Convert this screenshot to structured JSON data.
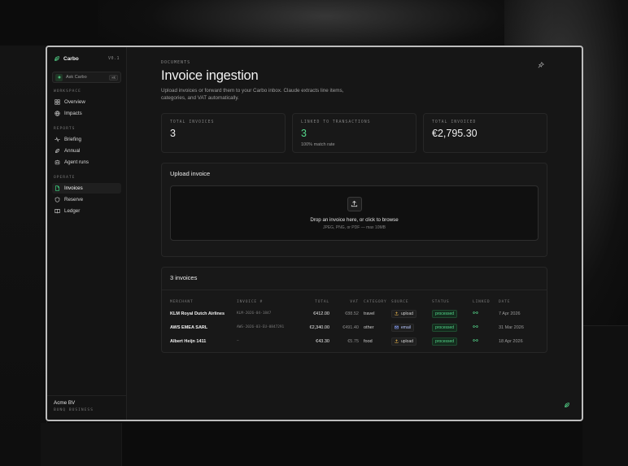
{
  "app": {
    "brand": "Carbo",
    "version": "V0.1"
  },
  "sidebar": {
    "ask_label": "Ask Carbo",
    "ask_shortcut": "⌘K",
    "sections": [
      {
        "label": "WORKSPACE",
        "items": [
          {
            "label": "Overview",
            "icon": "grid-icon"
          },
          {
            "label": "Impacts",
            "icon": "globe-icon"
          }
        ]
      },
      {
        "label": "REPORTS",
        "items": [
          {
            "label": "Briefing",
            "icon": "pulse-icon"
          },
          {
            "label": "Annual",
            "icon": "leaf-icon"
          },
          {
            "label": "Agent runs",
            "icon": "agent-icon"
          }
        ]
      },
      {
        "label": "OPERATE",
        "items": [
          {
            "label": "Invoices",
            "icon": "document-icon",
            "active": true
          },
          {
            "label": "Reserve",
            "icon": "shield-icon"
          },
          {
            "label": "Ledger",
            "icon": "book-icon"
          }
        ]
      }
    ],
    "footer": {
      "org": "Acme BV",
      "sub": "BUNQ BUSINESS"
    }
  },
  "page": {
    "eyebrow": "DOCUMENTS",
    "title": "Invoice ingestion",
    "description": "Upload invoices or forward them to your Carbo inbox. Claude extracts line items, categories, and VAT automatically."
  },
  "stats": [
    {
      "label": "TOTAL INVOICES",
      "value": "3",
      "sub": ""
    },
    {
      "label": "LINKED TO TRANSACTIONS",
      "value": "3",
      "sub": "100% match rate"
    },
    {
      "label": "TOTAL INVOICED",
      "value": "€2,795.30",
      "sub": ""
    }
  ],
  "upload": {
    "title": "Upload invoice",
    "drop_title": "Drop an invoice here, or click to browse",
    "drop_sub": "JPEG, PNG, or PDF — max 10MB"
  },
  "invoices": {
    "title": "3 invoices",
    "columns": [
      "MERCHANT",
      "INVOICE #",
      "TOTAL",
      "VAT",
      "CATEGORY",
      "SOURCE",
      "STATUS",
      "LINKED",
      "DATE"
    ],
    "rows": [
      {
        "merchant": "KLM Royal Dutch Airlines",
        "invoice": "KLM-2026-04-1847",
        "total": "€412.00",
        "vat": "€88.52",
        "category": "travel",
        "source": "upload",
        "status": "processed",
        "date": "7 Apr 2026"
      },
      {
        "merchant": "AWS EMEA SARL",
        "invoice": "AWS-2026-03-EU-0847291",
        "total": "€2,340.00",
        "vat": "€491.40",
        "category": "other",
        "source": "email",
        "status": "processed",
        "date": "31 Mar 2026"
      },
      {
        "merchant": "Albert Heijn 1411",
        "invoice": "–",
        "total": "€43.30",
        "vat": "€5.75",
        "category": "food",
        "source": "upload",
        "status": "processed",
        "date": "18 Apr 2026"
      }
    ]
  },
  "colors": {
    "accent": "#55d98c",
    "background": "#161616",
    "border": "#272727"
  }
}
